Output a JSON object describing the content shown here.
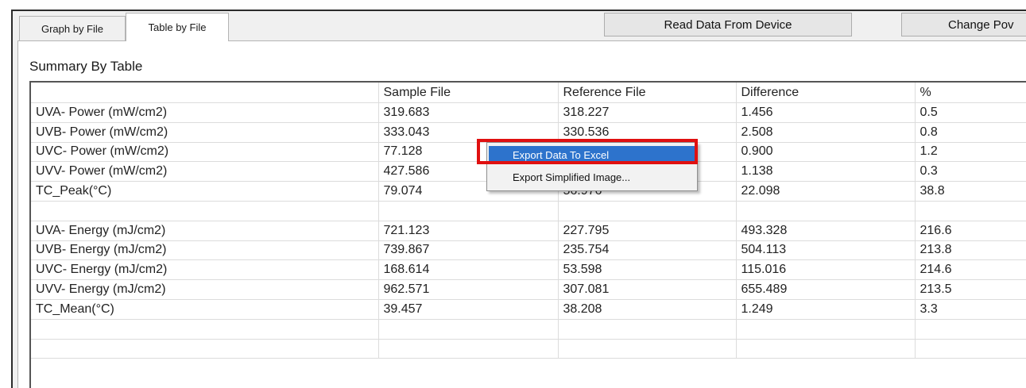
{
  "tabs": [
    {
      "label": "Graph by File"
    },
    {
      "label": "Table by File"
    }
  ],
  "toolbar": {
    "read_label": "Read Data From Device",
    "change_label": "Change Pov"
  },
  "summary_label": "Summary By Table",
  "table": {
    "headers": [
      "",
      "Sample File",
      "Reference File",
      "Difference",
      "%"
    ],
    "rows": [
      [
        "UVA- Power (mW/cm2)",
        "319.683",
        "318.227",
        "1.456",
        "0.5"
      ],
      [
        "UVB- Power (mW/cm2)",
        "333.043",
        "330.536",
        "2.508",
        "0.8"
      ],
      [
        "UVC- Power (mW/cm2)",
        "77.128",
        "",
        "0.900",
        "1.2"
      ],
      [
        "UVV- Power (mW/cm2)",
        "427.586",
        "",
        "1.138",
        "0.3"
      ],
      [
        "TC_Peak(°C)",
        "79.074",
        "56.976",
        "22.098",
        "38.8"
      ],
      [
        "",
        "",
        "",
        "",
        ""
      ],
      [
        "UVA- Energy (mJ/cm2)",
        "721.123",
        "227.795",
        "493.328",
        "216.6"
      ],
      [
        "UVB- Energy (mJ/cm2)",
        "739.867",
        "235.754",
        "504.113",
        "213.8"
      ],
      [
        "UVC- Energy (mJ/cm2)",
        "168.614",
        "53.598",
        "115.016",
        "214.6"
      ],
      [
        "UVV- Energy (mJ/cm2)",
        "962.571",
        "307.081",
        "655.489",
        "213.5"
      ],
      [
        "TC_Mean(°C)",
        "39.457",
        "38.208",
        "1.249",
        "3.3"
      ],
      [
        "",
        "",
        "",
        "",
        ""
      ],
      [
        "",
        "",
        "",
        "",
        ""
      ]
    ]
  },
  "context_menu": {
    "items": [
      {
        "label": "Export Data To Excel"
      },
      {
        "label": "Export Simplified Image..."
      }
    ]
  },
  "colors": {
    "menu_selection": "#2d73cc",
    "highlight_border": "#e01010"
  }
}
